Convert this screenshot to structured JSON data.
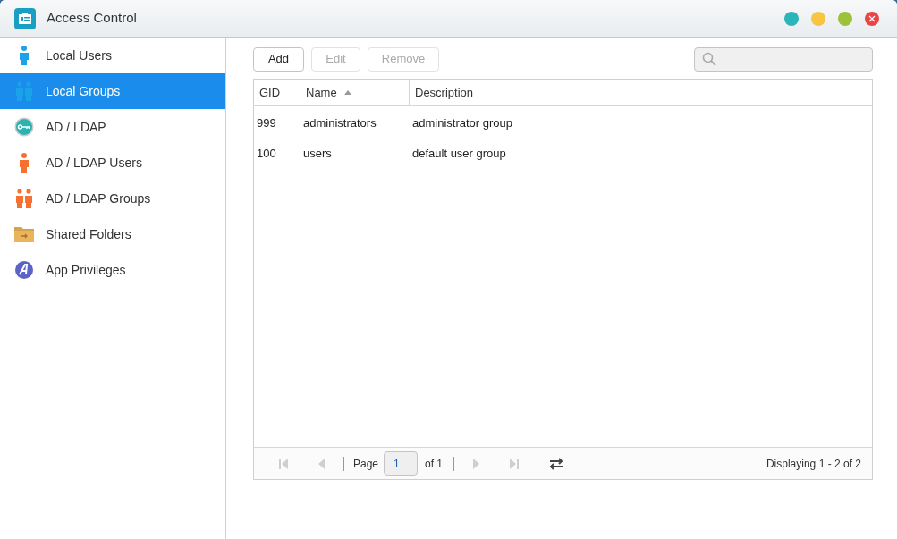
{
  "window": {
    "title": "Access Control"
  },
  "sidebar": {
    "items": [
      {
        "label": "Local Users",
        "kind": "user",
        "color": "#1aa3e8",
        "selected": false
      },
      {
        "label": "Local Groups",
        "kind": "group",
        "color": "#1aa3e8",
        "selected": true
      },
      {
        "label": "AD / LDAP",
        "kind": "key",
        "color": "#2bb3b1",
        "selected": false
      },
      {
        "label": "AD / LDAP Users",
        "kind": "user",
        "color": "#f47132",
        "selected": false
      },
      {
        "label": "AD / LDAP Groups",
        "kind": "group",
        "color": "#f47132",
        "selected": false
      },
      {
        "label": "Shared Folders",
        "kind": "folder",
        "color": "#e9b55a",
        "selected": false
      },
      {
        "label": "App Privileges",
        "kind": "app",
        "color": "#5b63c9",
        "selected": false
      }
    ]
  },
  "toolbar": {
    "buttons": [
      {
        "label": "Add",
        "disabled": false
      },
      {
        "label": "Edit",
        "disabled": true
      },
      {
        "label": "Remove",
        "disabled": true
      }
    ]
  },
  "table": {
    "columns": [
      {
        "label": "GID",
        "sorted": false
      },
      {
        "label": "Name",
        "sorted": true
      },
      {
        "label": "Description",
        "sorted": false
      }
    ],
    "rows": [
      [
        "999",
        "administrators",
        "administrator group"
      ],
      [
        "100",
        "users",
        "default user group"
      ]
    ]
  },
  "pager": {
    "first_disabled": true,
    "prev_disabled": true,
    "next_disabled": true,
    "last_disabled": true,
    "page_label": "Page",
    "page": "1",
    "of": "of 1",
    "summary": "Displaying 1 - 2 of 2"
  }
}
